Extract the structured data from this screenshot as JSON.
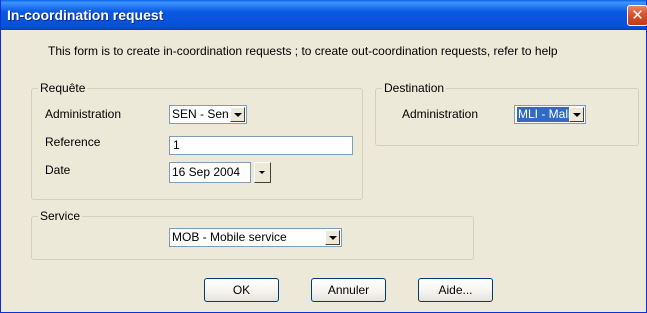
{
  "window": {
    "title": "In-coordination request"
  },
  "info_text": "This form is to create in-coordination requests ; to create out-coordination requests, refer to help",
  "requete": {
    "legend": "Requête",
    "administration_label": "Administration",
    "administration_value": "SEN - Sen",
    "reference_label": "Reference",
    "reference_value": "1",
    "date_label": "Date",
    "date_value": "16 Sep 2004"
  },
  "destination": {
    "legend": "Destination",
    "administration_label": "Administration",
    "administration_value": "MLI - Mali"
  },
  "service": {
    "legend": "Service",
    "value": "MOB - Mobile service"
  },
  "buttons": {
    "ok": "OK",
    "cancel": "Annuler",
    "help": "Aide..."
  },
  "icons": {
    "close": "close-icon",
    "dropdown": "chevron-down-icon"
  }
}
